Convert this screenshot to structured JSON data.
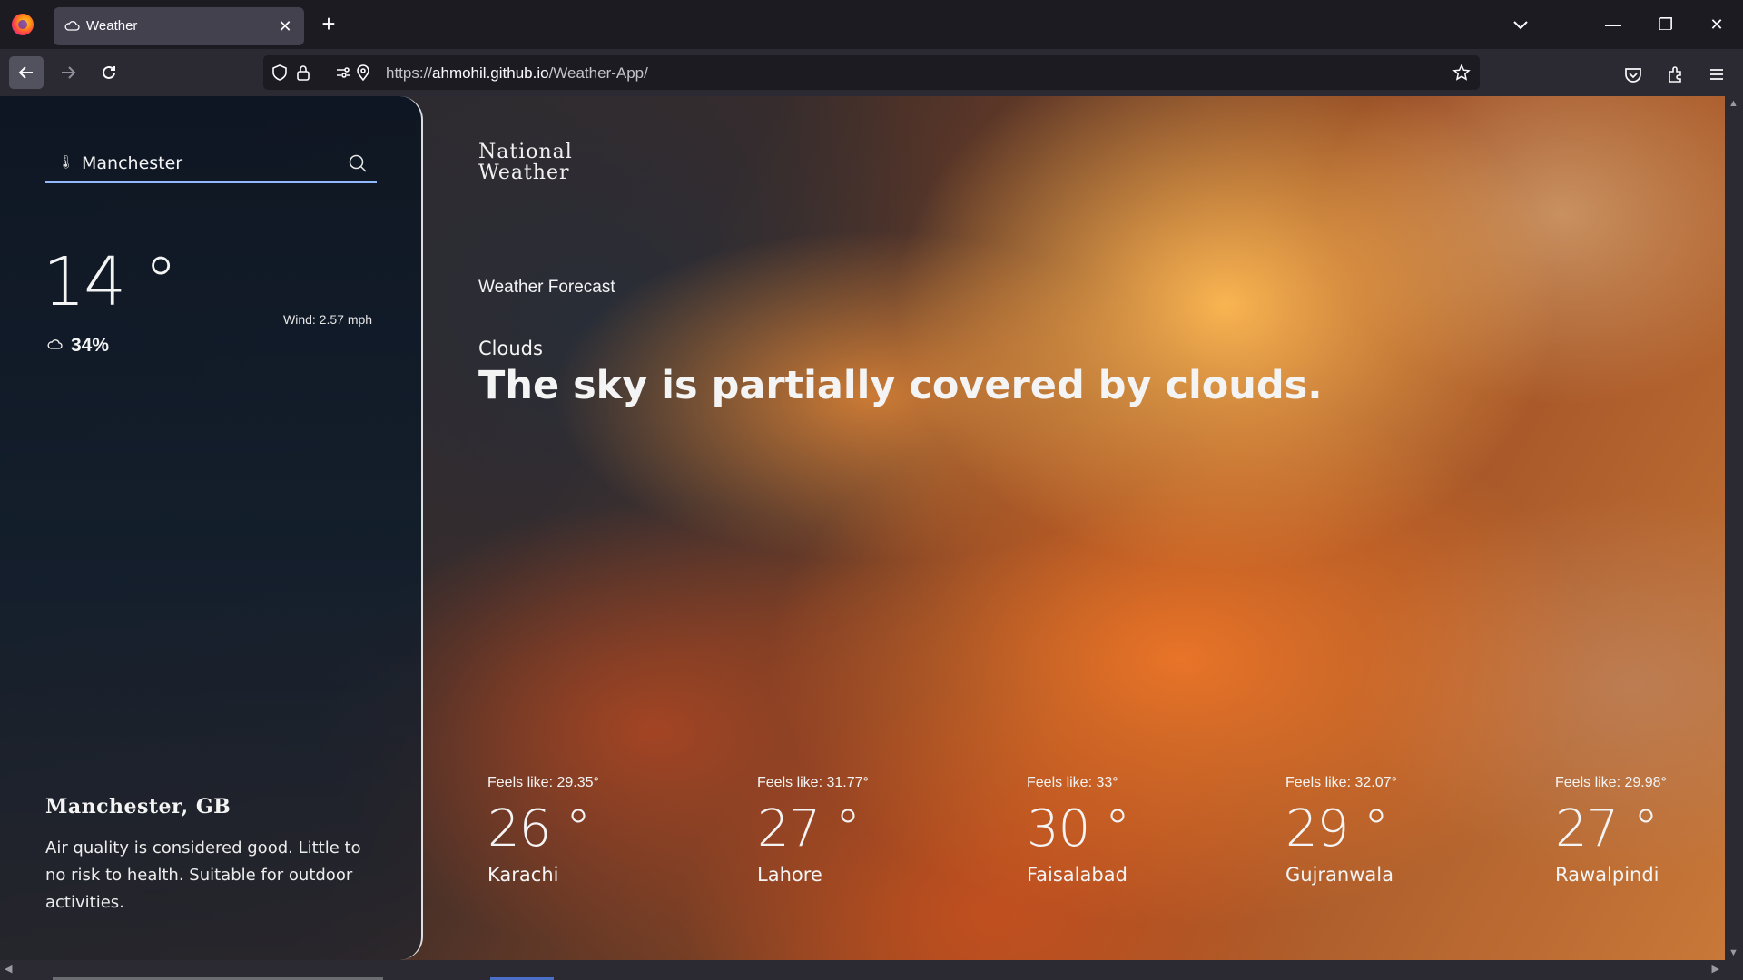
{
  "browser": {
    "tab_title": "Weather",
    "url_prefix": "https://",
    "url_host": "ahmohil.github.io",
    "url_path": "/Weather-App/"
  },
  "sidebar": {
    "search_value": "Manchester",
    "temperature": "14 °",
    "wind": "Wind: 2.57 mph",
    "humidity": "34%",
    "city": "Manchester, GB",
    "air_quality": "Air quality is considered good. Little to no risk to health. Suitable for outdoor activities."
  },
  "main": {
    "brand_line1": "National",
    "brand_line2": "Weather",
    "forecast_heading": "Weather Forecast",
    "condition": "Clouds",
    "description": "The sky is partially covered by clouds."
  },
  "cities": [
    {
      "feels": "Feels like: 29.35°",
      "temp": "26 °",
      "name": "Karachi"
    },
    {
      "feels": "Feels like: 31.77°",
      "temp": "27 °",
      "name": "Lahore"
    },
    {
      "feels": "Feels like: 33°",
      "temp": "30 °",
      "name": "Faisalabad"
    },
    {
      "feels": "Feels like: 32.07°",
      "temp": "29 °",
      "name": "Gujranwala"
    },
    {
      "feels": "Feels like: 29.98°",
      "temp": "27 °",
      "name": "Rawalpindi"
    }
  ],
  "colors": {
    "accent_underline": "#8fb8ff",
    "chrome_bg": "#1c1b22",
    "toolbar_bg": "#2b2a33"
  }
}
